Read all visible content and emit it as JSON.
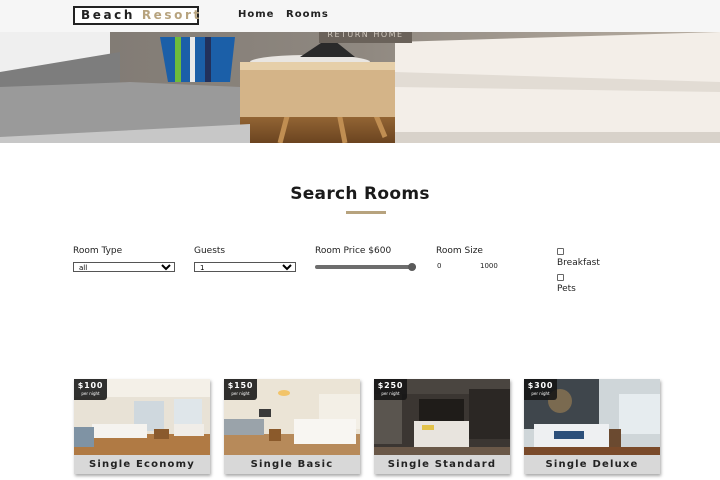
{
  "navbar": {
    "logo_part1": "Beach ",
    "logo_part2": "Resort",
    "links": [
      "Home",
      "Rooms"
    ]
  },
  "hero": {
    "button_label": "RETURN HOME"
  },
  "search": {
    "title": "Search Rooms",
    "room_type_label": "Room Type",
    "room_type_value": "all",
    "guests_label": "Guests",
    "guests_value": "1",
    "price_label": "Room Price $600",
    "price_level_fraction": 1.0,
    "size_label": "Room Size",
    "size_min": "0",
    "size_max": "1000",
    "breakfast_label": "Breakfast",
    "pets_label": "Pets"
  },
  "rooms": [
    {
      "name": "Single Economy",
      "price": "$100",
      "per": "per night"
    },
    {
      "name": "Single Basic",
      "price": "$150",
      "per": "per night"
    },
    {
      "name": "Single Standard",
      "price": "$250",
      "per": "per night"
    },
    {
      "name": "Single Deluxe",
      "price": "$300",
      "per": "per night"
    }
  ],
  "colors": {
    "accent": "#b7a37e",
    "navbar_bg": "#f6f6f6",
    "card_caption_bg": "#d8d8d8"
  }
}
